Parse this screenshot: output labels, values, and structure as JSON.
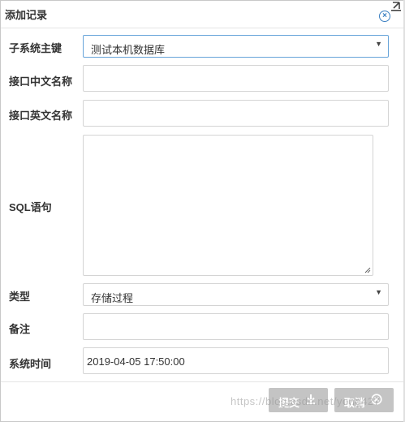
{
  "dialog": {
    "title": "添加记录"
  },
  "form": {
    "subsystem_key": {
      "label": "子系统主键",
      "value": "测试本机数据库"
    },
    "interface_cn_name": {
      "label": "接口中文名称",
      "value": ""
    },
    "interface_en_name": {
      "label": "接口英文名称",
      "value": ""
    },
    "sql_statement": {
      "label": "SQL语句",
      "value": ""
    },
    "type": {
      "label": "类型",
      "value": "存储过程"
    },
    "remark": {
      "label": "备注",
      "value": ""
    },
    "system_time": {
      "label": "系统时间",
      "value": "2019-04-05 17:50:00"
    }
  },
  "footer": {
    "submit_label": "提交",
    "cancel_label": "取消"
  },
  "watermark": "https://blog.csdn.net/yong427",
  "colors": {
    "accent": "#3a7fc1",
    "button_bg": "#c4c4c4"
  }
}
